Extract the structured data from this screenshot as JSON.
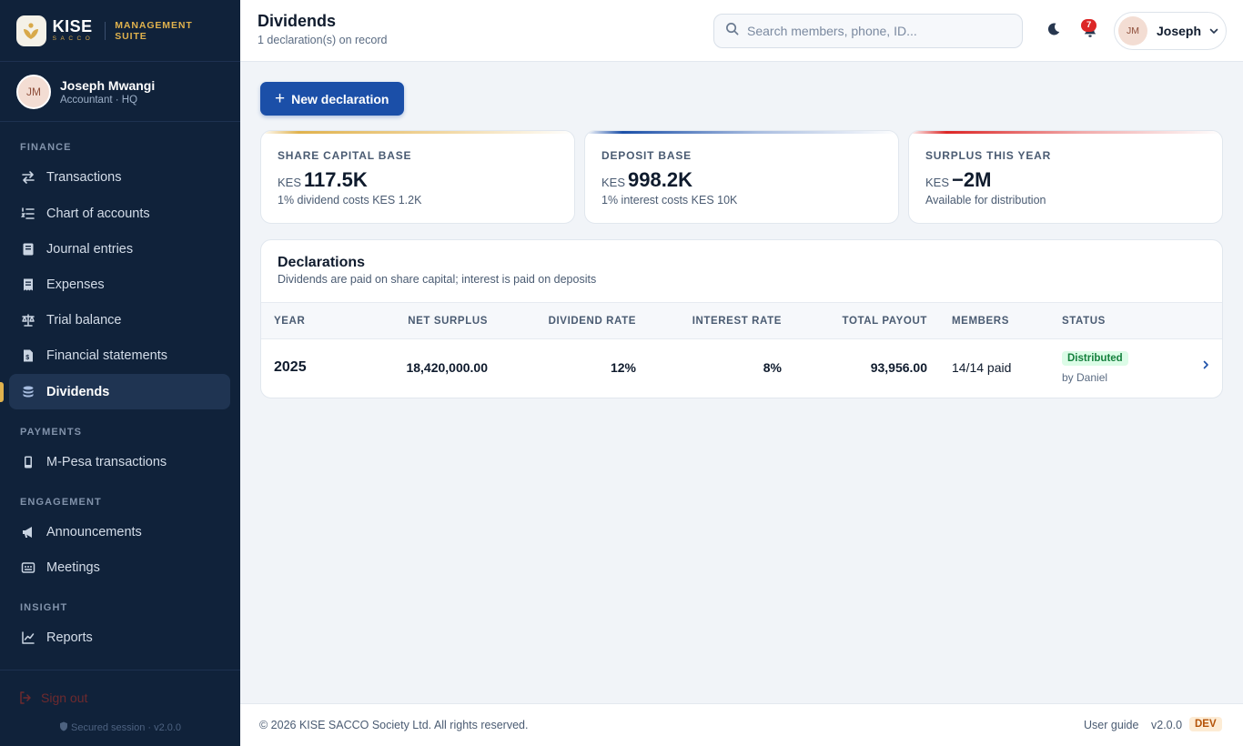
{
  "brand": {
    "name": "KISE",
    "tagline": "SACCO",
    "suite": "MANAGEMENT SUITE"
  },
  "sidebar_user": {
    "initials": "JM",
    "name": "Joseph Mwangi",
    "role": "Accountant · HQ"
  },
  "nav": {
    "sections": {
      "finance": "FINANCE",
      "payments": "PAYMENTS",
      "engagement": "ENGAGEMENT",
      "insight": "INSIGHT"
    },
    "items": [
      {
        "label": "Transactions",
        "icon": "transfer-arrows-icon"
      },
      {
        "label": "Chart of accounts",
        "icon": "list-ordered-icon"
      },
      {
        "label": "Journal entries",
        "icon": "book-icon"
      },
      {
        "label": "Expenses",
        "icon": "receipt-icon"
      },
      {
        "label": "Trial balance",
        "icon": "scale-icon"
      },
      {
        "label": "Financial statements",
        "icon": "document-icon"
      },
      {
        "label": "Dividends",
        "icon": "coins-icon",
        "active": true
      },
      {
        "label": "M-Pesa transactions",
        "icon": "phone-icon"
      },
      {
        "label": "Announcements",
        "icon": "megaphone-icon"
      },
      {
        "label": "Meetings",
        "icon": "calendar-icon"
      },
      {
        "label": "Reports",
        "icon": "line-chart-icon"
      }
    ]
  },
  "sidebar_footer": {
    "signout": "Sign out",
    "secure": "Secured session · v2.0.0"
  },
  "header": {
    "title": "Dividends",
    "subtitle": "1 declaration(s) on record",
    "search_placeholder": "Search members, phone, ID...",
    "notification_count": "7",
    "user_initials": "JM",
    "user_name": "Joseph"
  },
  "actions": {
    "new_declaration": "New declaration"
  },
  "stats": [
    {
      "label": "SHARE CAPITAL BASE",
      "currency": "KES",
      "value": "117.5K",
      "sub": "1% dividend costs KES 1.2K",
      "accent": "#e0b24d"
    },
    {
      "label": "DEPOSIT BASE",
      "currency": "KES",
      "value": "998.2K",
      "sub": "1% interest costs KES 10K",
      "accent": "#1b4fa8"
    },
    {
      "label": "SURPLUS THIS YEAR",
      "currency": "KES",
      "value": "−2M",
      "sub": "Available for distribution",
      "accent": "#dc2626"
    }
  ],
  "declarations": {
    "title": "Declarations",
    "subtitle": "Dividends are paid on share capital; interest is paid on deposits",
    "columns": [
      "YEAR",
      "NET SURPLUS",
      "DIVIDEND RATE",
      "INTEREST RATE",
      "TOTAL PAYOUT",
      "MEMBERS",
      "STATUS"
    ],
    "rows": [
      {
        "year": "2025",
        "net_surplus": "18,420,000.00",
        "dividend_rate": "12%",
        "interest_rate": "8%",
        "total_payout": "93,956.00",
        "members": "14/14 paid",
        "status": "Distributed",
        "status_by": "by Daniel"
      }
    ]
  },
  "footer": {
    "copyright": "© 2026 KISE SACCO Society Ltd. All rights reserved.",
    "guide": "User guide",
    "version": "v2.0.0",
    "env": "DEV"
  },
  "colors": {
    "sidebar_bg": "#10223a",
    "primary": "#1b4fa8",
    "gold": "#e0b24d",
    "danger": "#dc2626",
    "success": "#15803d"
  }
}
